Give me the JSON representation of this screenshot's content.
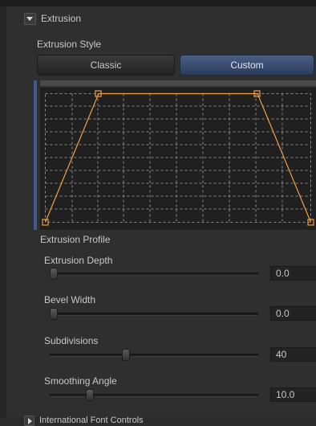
{
  "extrusion": {
    "header": "Extrusion",
    "style_label": "Extrusion Style",
    "buttons": {
      "classic": "Classic",
      "custom": "Custom"
    },
    "selected_style": "Custom",
    "profile_label": "Extrusion Profile",
    "profile_colors": {
      "curve": "#f0a040",
      "grid": "#8a8a8a",
      "accent": "#3f5a8c"
    }
  },
  "sliders": [
    {
      "label": "Extrusion Depth",
      "value": "0.0",
      "fraction": 0.0
    },
    {
      "label": "Bevel Width",
      "value": "0.0",
      "fraction": 0.0
    },
    {
      "label": "Subdivisions",
      "value": "40",
      "fraction": 0.36
    },
    {
      "label": "Smoothing Angle",
      "value": "10.0",
      "fraction": 0.18
    }
  ],
  "footer": {
    "header": "International Font Controls"
  }
}
